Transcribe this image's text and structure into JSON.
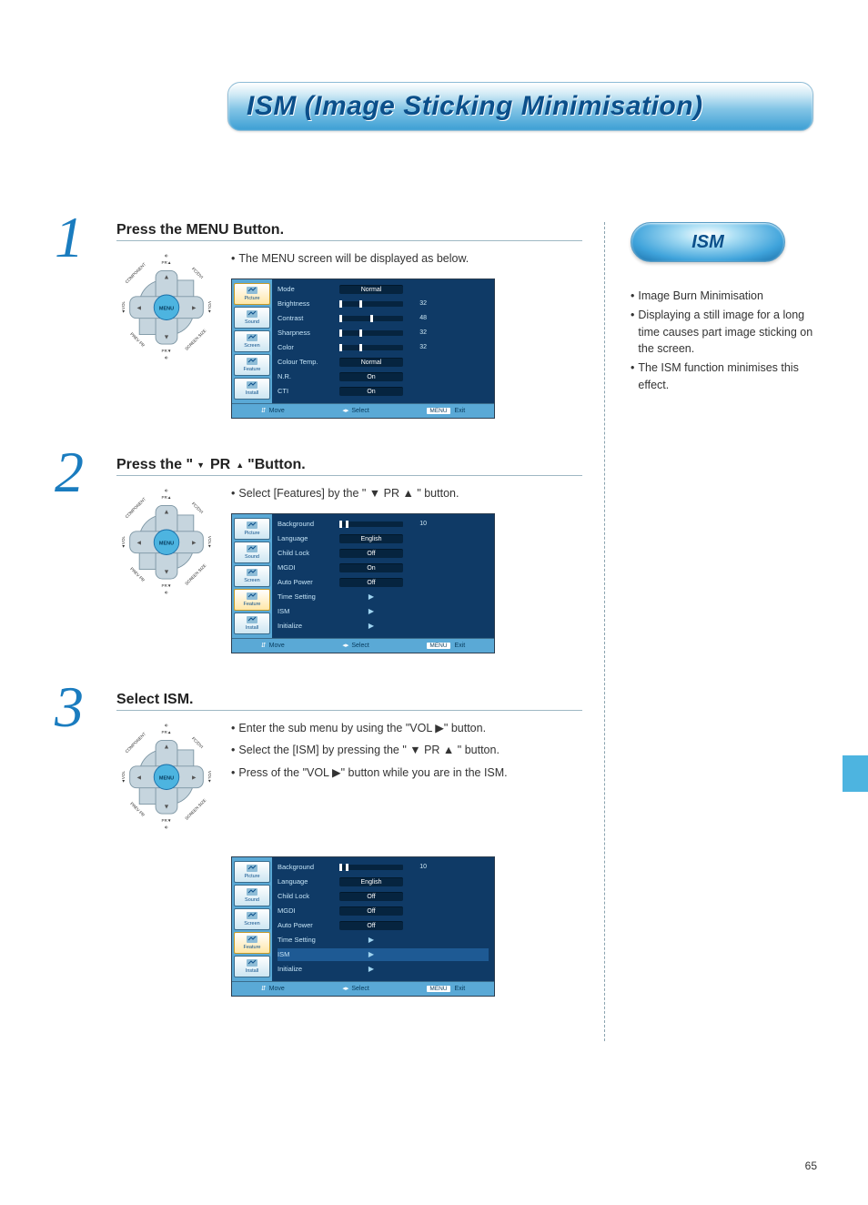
{
  "title": "ISM (Image Sticking Minimisation)",
  "page_number": "65",
  "right_badge": "ISM",
  "right_notes": [
    "Image Burn Minimisation",
    "Displaying a still image for a long time causes part image sticking on the screen.",
    "The ISM function minimises this effect."
  ],
  "steps": [
    {
      "num": "1",
      "heading": "Press the MENU Button.",
      "notes": [
        "The MENU screen will be displayed as below."
      ],
      "dpad_labels": {
        "up": "PR▲",
        "down": "PR▼",
        "left": "◄VOL",
        "right": "VOL►",
        "center": "MENU",
        "nw": "COMPONENT",
        "ne": "PC/DVI",
        "sw": "PREV PR",
        "se": "SCREEN SIZE"
      },
      "osd": {
        "icons": [
          "Picture",
          "Sound",
          "Screen",
          "Feature",
          "Install"
        ],
        "active_icon": 0,
        "rows": [
          {
            "label": "Mode",
            "type": "box",
            "value": "Normal"
          },
          {
            "label": "Brightness",
            "type": "slider",
            "pos": 0.32,
            "num": "32"
          },
          {
            "label": "Contrast",
            "type": "slider",
            "pos": 0.48,
            "num": "48"
          },
          {
            "label": "Sharpness",
            "type": "slider",
            "pos": 0.32,
            "num": "32"
          },
          {
            "label": "Color",
            "type": "slider",
            "pos": 0.32,
            "num": "32"
          },
          {
            "label": "Colour Temp.",
            "type": "box",
            "value": "Normal"
          },
          {
            "label": "N.R.",
            "type": "box",
            "value": "On"
          },
          {
            "label": "CTI",
            "type": "box",
            "value": "On"
          }
        ],
        "footer": {
          "move": "Move",
          "select": "Select",
          "exit": "Exit",
          "menu_chip": "MENU"
        }
      }
    },
    {
      "num": "2",
      "heading_parts": [
        "Press the \" ",
        "PR",
        " \"Button."
      ],
      "notes": [
        "Select [Features] by the \" ▼ PR ▲ \" button."
      ],
      "dpad_labels": {
        "up": "PR▲",
        "down": "PR▼",
        "left": "◄VOL",
        "right": "VOL►",
        "center": "MENU",
        "nw": "COMPONENT",
        "ne": "PC/DVI",
        "sw": "PREV PR",
        "se": "SCREEN SIZE"
      },
      "osd": {
        "icons": [
          "Picture",
          "Sound",
          "Screen",
          "Feature",
          "Install"
        ],
        "active_icon": 3,
        "rows": [
          {
            "label": "Background",
            "type": "slider",
            "pos": 0.1,
            "num": "10"
          },
          {
            "label": "Language",
            "type": "box",
            "value": "English"
          },
          {
            "label": "Child Lock",
            "type": "box",
            "value": "Off"
          },
          {
            "label": "MGDI",
            "type": "box",
            "value": "On"
          },
          {
            "label": "Auto Power",
            "type": "box",
            "value": "Off"
          },
          {
            "label": "Time Setting",
            "type": "arrow"
          },
          {
            "label": "ISM",
            "type": "arrow"
          },
          {
            "label": "Initialize",
            "type": "arrow"
          }
        ],
        "footer": {
          "move": "Move",
          "select": "Select",
          "exit": "Exit",
          "menu_chip": "MENU"
        }
      }
    },
    {
      "num": "3",
      "heading": "Select ISM.",
      "notes": [
        "Enter the sub menu by using the \"VOL ▶\" button.",
        "Select the [ISM] by pressing the \" ▼ PR ▲ \" button.",
        "Press of the \"VOL ▶\" button while you are in the ISM."
      ],
      "dpad_labels": {
        "up": "PR▲",
        "down": "PR▼",
        "left": "◄VOL",
        "right": "VOL►",
        "center": "MENU",
        "nw": "COMPONENT",
        "ne": "PC/DVI",
        "sw": "PREV PR",
        "se": "SCREEN SIZE"
      },
      "osd": {
        "icons": [
          "Picture",
          "Sound",
          "Screen",
          "Feature",
          "Install"
        ],
        "active_icon": 3,
        "highlight_row": 6,
        "rows": [
          {
            "label": "Background",
            "type": "slider",
            "pos": 0.1,
            "num": "10"
          },
          {
            "label": "Language",
            "type": "box",
            "value": "English"
          },
          {
            "label": "Child Lock",
            "type": "box",
            "value": "Off"
          },
          {
            "label": "MGDI",
            "type": "box",
            "value": "Off"
          },
          {
            "label": "Auto Power",
            "type": "box",
            "value": "Off"
          },
          {
            "label": "Time Setting",
            "type": "arrow"
          },
          {
            "label": "ISM",
            "type": "arrow"
          },
          {
            "label": "Initialize",
            "type": "arrow"
          }
        ],
        "footer": {
          "move": "Move",
          "select": "Select",
          "exit": "Exit",
          "menu_chip": "MENU"
        }
      }
    }
  ]
}
